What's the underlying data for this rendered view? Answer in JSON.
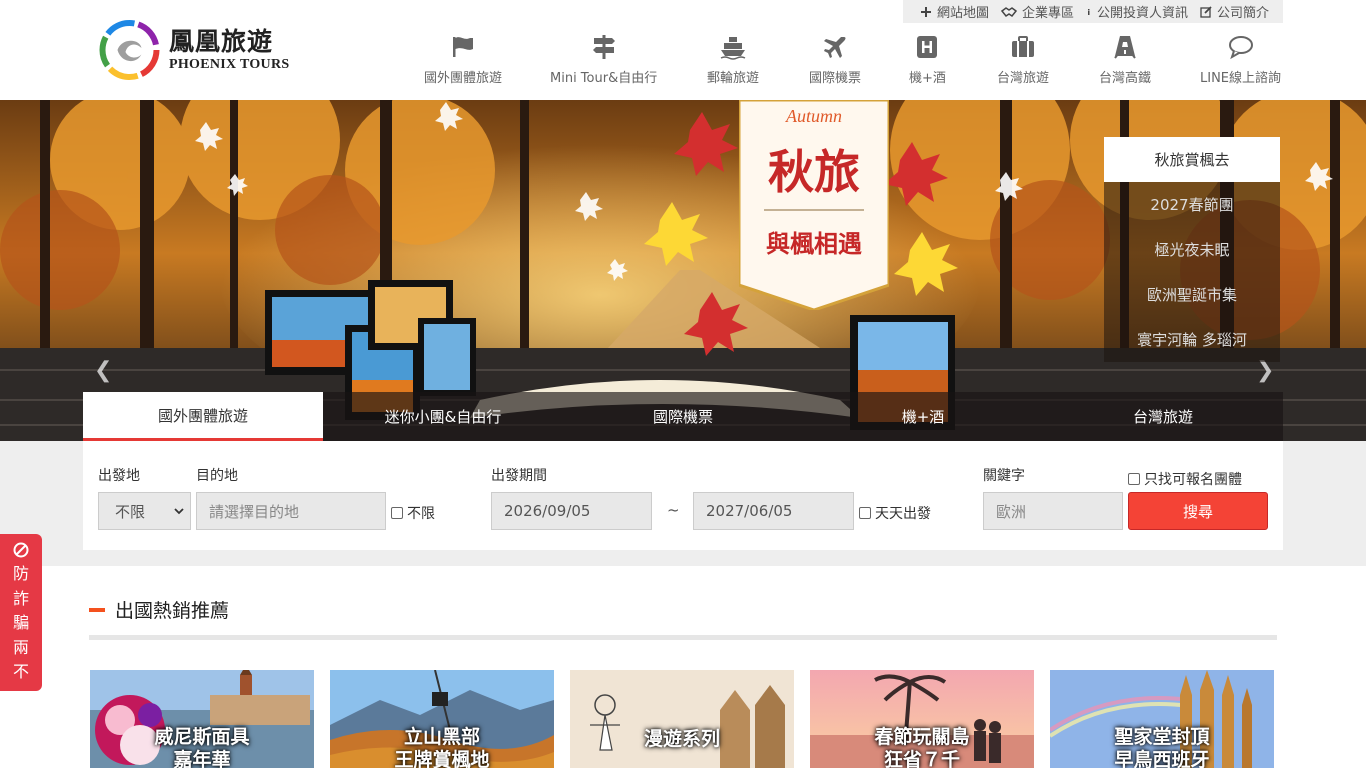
{
  "topbar": {
    "links": [
      {
        "label": "網站地圖",
        "icon": "plus-icon"
      },
      {
        "label": "企業專區",
        "icon": "handshake-icon"
      },
      {
        "label": "公開投資人資訊",
        "icon": "info-icon"
      },
      {
        "label": "公司簡介",
        "icon": "edit-icon"
      }
    ]
  },
  "logo": {
    "name_zh": "鳳凰旅遊",
    "name_en": "PHOENIX TOURS"
  },
  "nav": [
    {
      "label": "國外團體旅遊",
      "icon": "flag-icon"
    },
    {
      "label": "Mini Tour&自由行",
      "icon": "signpost-icon"
    },
    {
      "label": "郵輪旅遊",
      "icon": "ship-icon"
    },
    {
      "label": "國際機票",
      "icon": "plane-icon"
    },
    {
      "label": "機+酒",
      "icon": "hotel-icon"
    },
    {
      "label": "台灣旅遊",
      "icon": "suitcase-icon"
    },
    {
      "label": "台灣高鐵",
      "icon": "train-icon"
    },
    {
      "label": "LINE線上諮詢",
      "icon": "chat-icon"
    }
  ],
  "hero": {
    "badge_top": "Autumn",
    "badge_main": "秋旅",
    "badge_sub": "與楓相遇",
    "slides": [
      "秋旅賞楓去",
      "2027春節團",
      "極光夜未眠",
      "歐洲聖誕市集",
      "寰宇河輪 多瑙河"
    ]
  },
  "tabs": [
    "國外團體旅遊",
    "迷你小團&自由行",
    "國際機票",
    "機+酒",
    "台灣旅遊"
  ],
  "search": {
    "depart_label": "出發地",
    "depart_value": "不限",
    "dest_label": "目的地",
    "dest_placeholder": "請選擇目的地",
    "dest_any": "不限",
    "period_label": "出發期間",
    "date_from": "2026/09/05",
    "tilde": "~",
    "date_to": "2027/06/05",
    "daily": "天天出發",
    "keyword_label": "關鍵字",
    "keyword_value": "歐洲",
    "only_open": "只找可報名團體",
    "button": "搜尋"
  },
  "section": {
    "title": "出國熱銷推薦"
  },
  "cards": [
    {
      "title": "威尼斯面具\n嘉年華"
    },
    {
      "title": "立山黑部\n王牌賞楓地"
    },
    {
      "title": "漫遊系列"
    },
    {
      "title": "春節玩關島\n狂省７千"
    },
    {
      "title": "聖家堂封頂\n早鳥西班牙"
    }
  ],
  "scam_tab": {
    "chars": [
      "防",
      "詐",
      "騙",
      "兩",
      "不"
    ]
  },
  "colors": {
    "accent": "#f44336",
    "tab_active": "#e53935",
    "section_dash": "#f4511e",
    "scam": "#e53945"
  }
}
